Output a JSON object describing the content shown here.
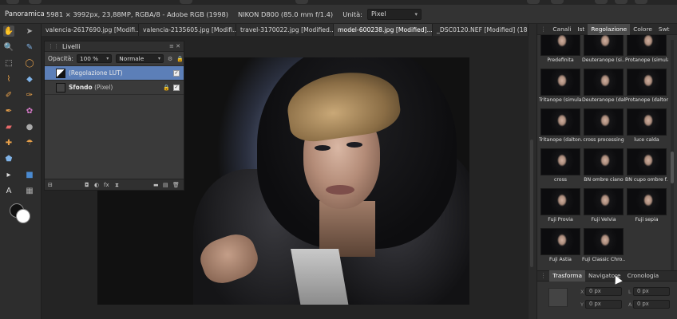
{
  "context_bar": {
    "persona": "Panoramica",
    "doc_info": "5981 × 3992px, 23,88MP, RGBA/8 - Adobe RGB (1998)",
    "camera_info": "NIKON D800 (85.0 mm f/1.4)",
    "units_label": "Unità:",
    "units_value": "Pixel"
  },
  "tabs": [
    {
      "label": "valencia-2617690.jpg [Modifi..."
    },
    {
      "label": "valencia-2135605.jpg [Modifi..."
    },
    {
      "label": "travel-3170022.jpg [Modified..."
    },
    {
      "label": "model-600238.jpg [Modified]..."
    },
    {
      "label": "_DSC0120.NEF [Modified] (18..."
    }
  ],
  "layers_panel": {
    "title": "Livelli",
    "opacity_label": "Opacità:",
    "opacity_value": "100 %",
    "blend_mode": "Normale",
    "layers": [
      {
        "name": "(Regolazione LUT)",
        "kind": ""
      },
      {
        "name": "Sfondo",
        "kind": "(Pixel)"
      }
    ]
  },
  "right_panel": {
    "tabs": [
      "Canali",
      "Ist",
      "Regolazione",
      "Colore",
      "Swt"
    ],
    "active_tab": "Regolazione",
    "presets": [
      {
        "label": "Predefinita",
        "tint": "#6e6e8c"
      },
      {
        "label": "Deuteranope (si...",
        "tint": "#7a6f7a"
      },
      {
        "label": "Protanope (simula)",
        "tint": "#6f6a74"
      },
      {
        "label": "Tritanope (simula)",
        "tint": "#6a7a86"
      },
      {
        "label": "Deuteranope (dalt...",
        "tint": "#77707a"
      },
      {
        "label": "Protanope (dalton...",
        "tint": "#6e6b78"
      },
      {
        "label": "Tritanope (dalton...",
        "tint": "#7a5aa8"
      },
      {
        "label": "cross processing",
        "tint": "#4a6a9a"
      },
      {
        "label": "luce calda",
        "tint": "#8a6a48"
      },
      {
        "label": "cross",
        "tint": "#3a5a8a"
      },
      {
        "label": "BN ombre ciano",
        "tint": "#5a7a8a"
      },
      {
        "label": "BN cupo ombre f...",
        "tint": "#4a6a7a"
      },
      {
        "label": "Fuji Provia",
        "tint": "#55617a"
      },
      {
        "label": "Fuji Velvia",
        "tint": "#4e5a78"
      },
      {
        "label": "Fuji sepia",
        "tint": "#7a5440"
      },
      {
        "label": "Fuji Astia",
        "tint": "#5e6478"
      },
      {
        "label": "Fuji Classic Chro...",
        "tint": "#5a6070"
      }
    ],
    "bottom_tabs": [
      "Trasforma",
      "Navigatore",
      "Cronologia"
    ],
    "active_bottom_tab": "Trasforma",
    "transform": {
      "x_label": "X",
      "x_value": "0 px",
      "y_label": "Y",
      "y_value": "0 px",
      "w_label": "L",
      "w_value": "0 px",
      "h_label": "A",
      "h_value": "0 px"
    }
  },
  "colors": {
    "selection": "#5c7fb8",
    "panel": "#333333",
    "canvas": "#242424"
  }
}
